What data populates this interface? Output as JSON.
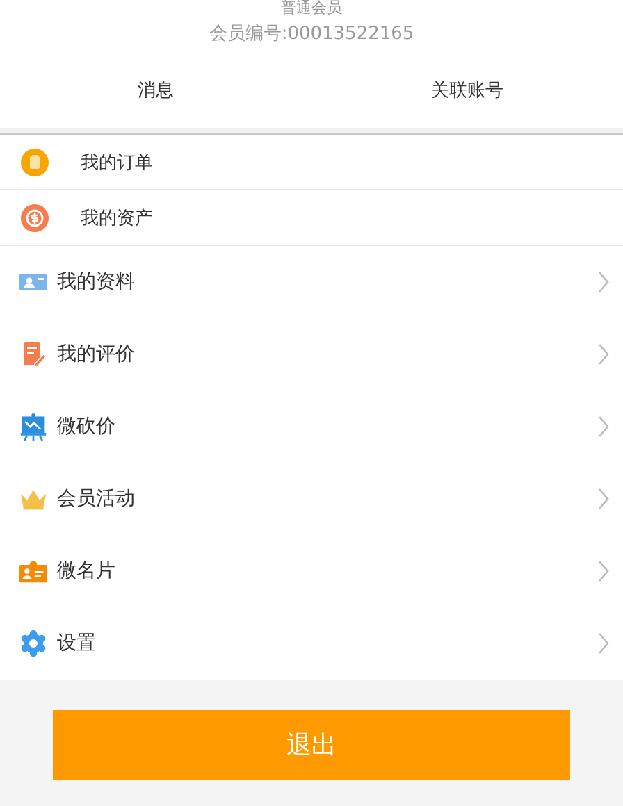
{
  "profile": {
    "level": "普通会员",
    "member_no": "会员编号:00013522165"
  },
  "tabs": [
    {
      "label": "消息"
    },
    {
      "label": "关联账号"
    }
  ],
  "quick_items": [
    {
      "label": "我的订单"
    },
    {
      "label": "我的资产"
    }
  ],
  "menu": [
    {
      "label": "我的资料"
    },
    {
      "label": "我的评价"
    },
    {
      "label": "微砍价"
    },
    {
      "label": "会员活动"
    },
    {
      "label": "微名片"
    },
    {
      "label": "设置"
    }
  ],
  "logout_button": "退出"
}
